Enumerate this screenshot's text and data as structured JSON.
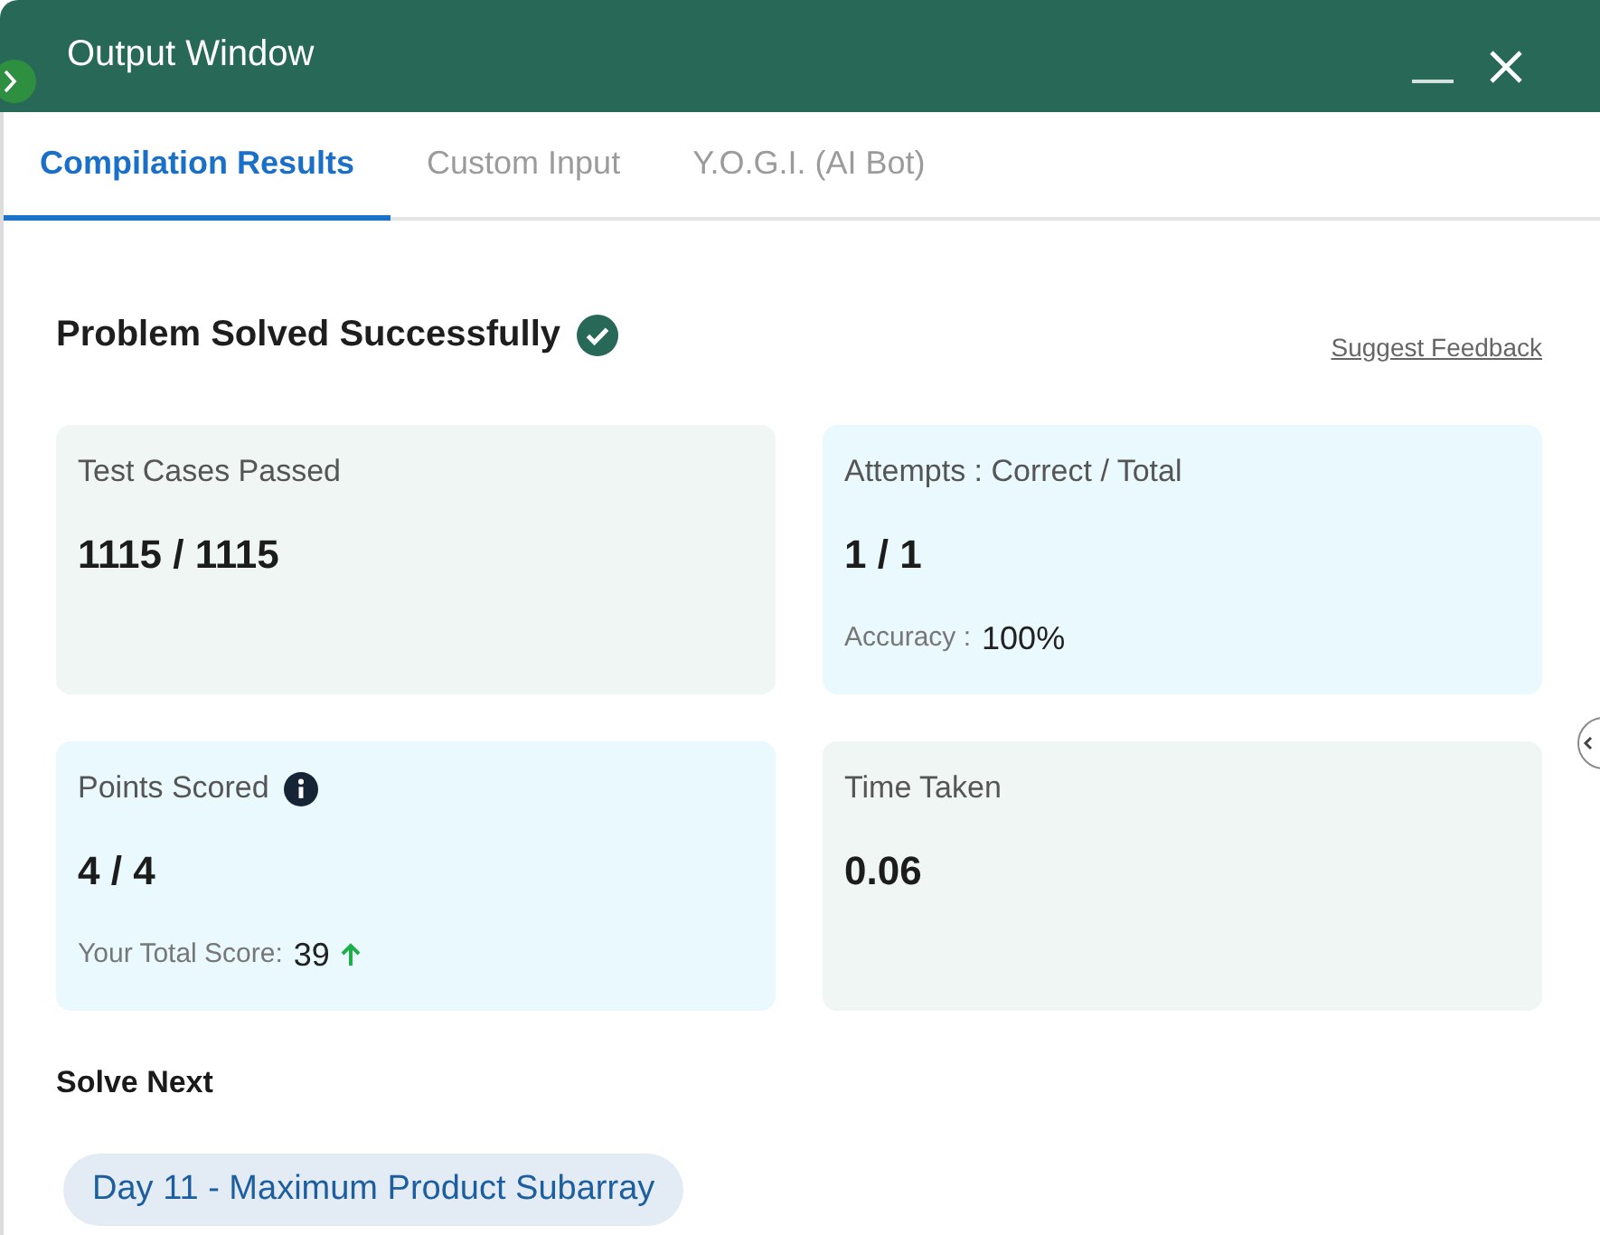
{
  "window": {
    "title": "Output Window"
  },
  "tabs": [
    {
      "label": "Compilation Results",
      "selected": true
    },
    {
      "label": "Custom Input",
      "selected": false
    },
    {
      "label": "Y.O.G.I. (AI Bot)",
      "selected": false
    }
  ],
  "result": {
    "title": "Problem Solved Successfully",
    "feedback_link": "Suggest Feedback"
  },
  "cards": [
    {
      "label": "Test Cases Passed",
      "info": false,
      "value": "1115 / 1115",
      "color": "#eff6f4"
    },
    {
      "label": "Attempts : Correct / Total",
      "info": false,
      "value": "1 / 1",
      "detail": {
        "label": "Accuracy :",
        "value": "100%",
        "rising": false
      },
      "color": "#e9f9fd"
    },
    {
      "label": "Points Scored",
      "info": true,
      "value": "4 / 4",
      "detail": {
        "label": "Your Total Score:",
        "value": "39",
        "rising": true
      },
      "color": "#e9f9fd"
    },
    {
      "label": "Time Taken",
      "info": false,
      "value": "0.06",
      "color": "#eff6f4"
    }
  ],
  "solve_next": {
    "heading": "Solve Next",
    "problems": [
      "Day 11 - Maximum Product Subarray"
    ]
  }
}
